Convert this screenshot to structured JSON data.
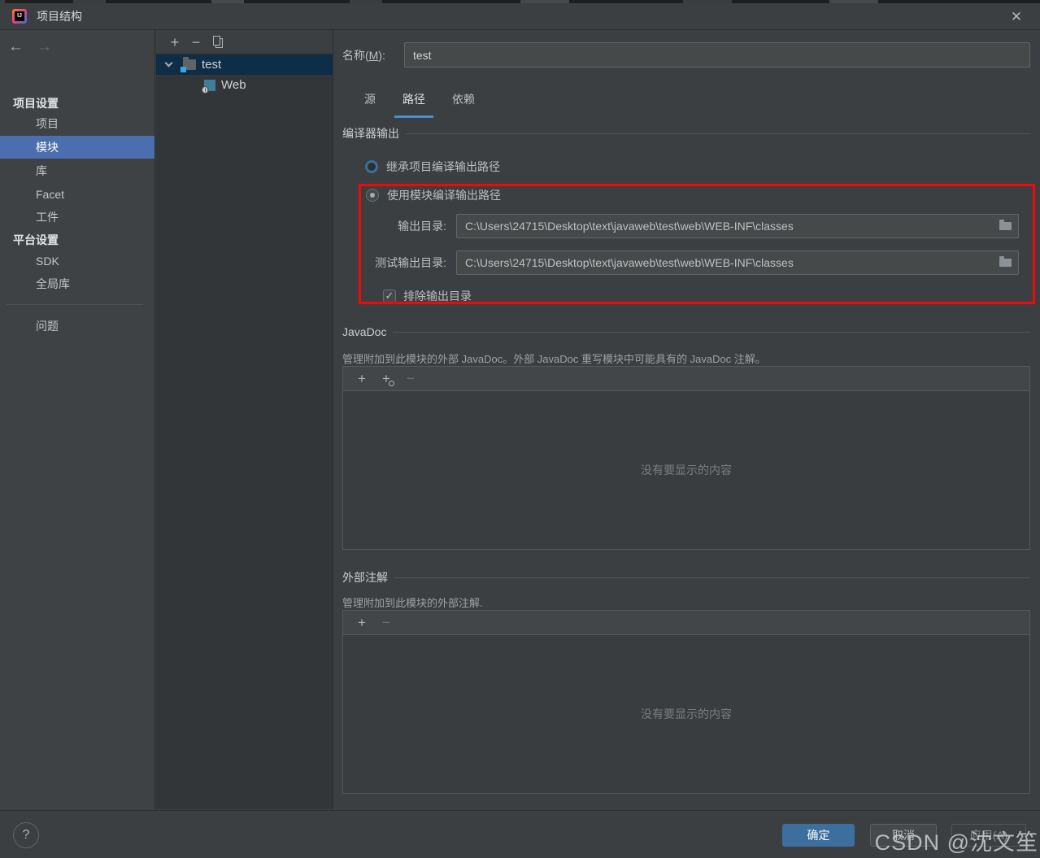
{
  "title_bar": {
    "title": "项目结构",
    "close_icon": "✕",
    "logo_text": "IJ"
  },
  "sidebar": {
    "back_icon": "←",
    "forward_icon": "→",
    "groups": [
      {
        "header": "项目设置",
        "items": [
          {
            "label": "项目"
          },
          {
            "label": "模块",
            "selected": true
          },
          {
            "label": "库"
          },
          {
            "label": "Facet"
          },
          {
            "label": "工件"
          }
        ]
      },
      {
        "header": "平台设置",
        "items": [
          {
            "label": "SDK"
          },
          {
            "label": "全局库"
          }
        ]
      }
    ],
    "bottom_items": [
      {
        "label": "问题"
      }
    ]
  },
  "tree": {
    "toolbar": {
      "add": "+",
      "remove": "−",
      "copy": "copy"
    },
    "nodes": [
      {
        "label": "test"
      },
      {
        "label": "Web"
      }
    ]
  },
  "main": {
    "name_label_prefix": "名称(",
    "name_label_mnemonic": "M",
    "name_label_suffix": "):",
    "name_value": "test",
    "tabs": [
      {
        "label": "源"
      },
      {
        "label": "路径",
        "active": true
      },
      {
        "label": "依赖"
      }
    ],
    "compiler_output": {
      "section_title": "编译器输出",
      "radio_inherit_label": "继承项目编译输出路径",
      "radio_module_label": "使用模块编译输出路径",
      "output_label": "输出目录:",
      "output_value": "C:\\Users\\24715\\Desktop\\text\\javaweb\\test\\web\\WEB-INF\\classes",
      "test_output_label": "测试输出目录:",
      "test_output_value": "C:\\Users\\24715\\Desktop\\text\\javaweb\\test\\web\\WEB-INF\\classes",
      "exclude_checkbox_label": "排除输出目录",
      "checkmark": "✓"
    },
    "javadoc": {
      "section_title": "JavaDoc",
      "description": "管理附加到此模块的外部 JavaDoc。外部 JavaDoc 重写模块中可能具有的 JavaDoc 注解。",
      "toolbar": {
        "add": "+",
        "add_url": "+",
        "remove": "−"
      },
      "empty_text": "没有要显示的内容"
    },
    "annotations": {
      "section_title": "外部注解",
      "description": "管理附加到此模块的外部注解.",
      "toolbar": {
        "add": "+",
        "remove": "−"
      },
      "empty_text": "没有要显示的内容"
    }
  },
  "footer": {
    "help_label": "?",
    "ok_label": "确定",
    "cancel_label": "取消",
    "apply_label": "应用(A)"
  },
  "watermark_text": "CSDN @沈文笙",
  "colors": {
    "sidebar_selection": "#4b6eaf",
    "tree_selection": "#0e2d47",
    "tab_underline": "#4a8fd1",
    "highlight_annotation": "#f50708",
    "ok_button": "#3c6e9e",
    "panel_bg": "#3c3f41"
  }
}
